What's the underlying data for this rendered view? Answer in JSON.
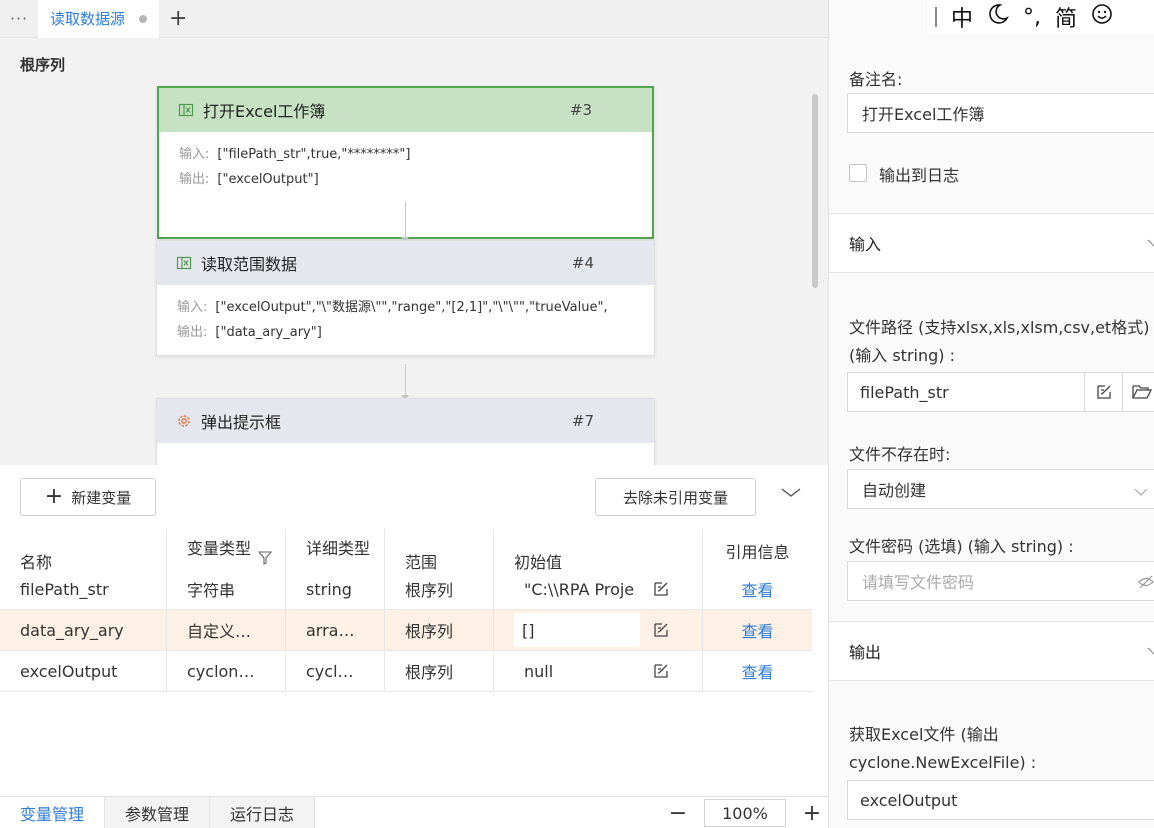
{
  "topbar": {
    "menu_dots": "···",
    "tab_title": "读取数据源",
    "add_tab": "+"
  },
  "canvas": {
    "breadcrumb": "根序列",
    "nodes": [
      {
        "title": "打开Excel工作簿",
        "num": "#3",
        "input_label": "输入:",
        "input_value": "[\"filePath_str\",true,\"********\"]",
        "output_label": "输出:",
        "output_value": "[\"excelOutput\"]",
        "icon": "excel-icon"
      },
      {
        "title": "读取范围数据",
        "num": "#4",
        "input_label": "输入:",
        "input_value": "[\"excelOutput\",\"\\\"数据源\\\"\",\"range\",\"[2,1]\",\"\\\"\\\"\",\"trueValue\",",
        "output_label": "输出:",
        "output_value": "[\"data_ary_ary\"]",
        "icon": "excel-icon"
      },
      {
        "title": "弹出提示框",
        "num": "#7",
        "icon": "gear-icon"
      }
    ]
  },
  "vartool": {
    "new_var": "新建变量",
    "remove_unused": "去除未引用变量"
  },
  "vtable": {
    "headers": {
      "name": "名称",
      "type": "变量类型",
      "detail": "详细类型",
      "scope": "范围",
      "init": "初始值",
      "ref": "引用信息"
    },
    "rows": [
      {
        "name": "filePath_str",
        "type": "字符串",
        "detail": "string",
        "scope": "根序列",
        "init": "\"C:\\\\RPA Proje",
        "ref": "查看"
      },
      {
        "name": "data_ary_ary",
        "type": "自定义…",
        "detail": "arra…",
        "scope": "根序列",
        "init": "[]",
        "ref": "查看"
      },
      {
        "name": "excelOutput",
        "type": "cyclon…",
        "detail": "cycl…",
        "scope": "根序列",
        "init": "null",
        "ref": "查看"
      }
    ]
  },
  "btabs": {
    "var_mgmt": "变量管理",
    "param_mgmt": "参数管理",
    "run_log": "运行日志",
    "zoom_minus": "−",
    "zoom_value": "100%",
    "zoom_plus": "+"
  },
  "rpanel": {
    "ime": {
      "zh": "中",
      "punct": "°,",
      "simp": "简"
    },
    "remark_label": "备注名:",
    "remark_value": "打开Excel工作簿",
    "log_label": "输出到日志",
    "input_section": "输入",
    "filepath_label_1": "文件路径 (支持xlsx,xls,xlsm,csv,et格式)",
    "filepath_label_2": "(输入 string) :",
    "filepath_value": "filePath_str",
    "notexist_label": "文件不存在时:",
    "notexist_value": "自动创建",
    "pwd_label": "文件密码 (选填) (输入 string) :",
    "pwd_placeholder": "请填写文件密码",
    "output_section": "输出",
    "getfile_label_1": "获取Excel文件 (输出",
    "getfile_label_2": "cyclone.NewExcelFile) :",
    "getfile_value": "excelOutput"
  },
  "colors": {
    "accent": "#2f7ed8",
    "active_node_border": "#52a552",
    "active_node_head": "#c6e2c3",
    "selected_row": "#fdf0e4"
  }
}
